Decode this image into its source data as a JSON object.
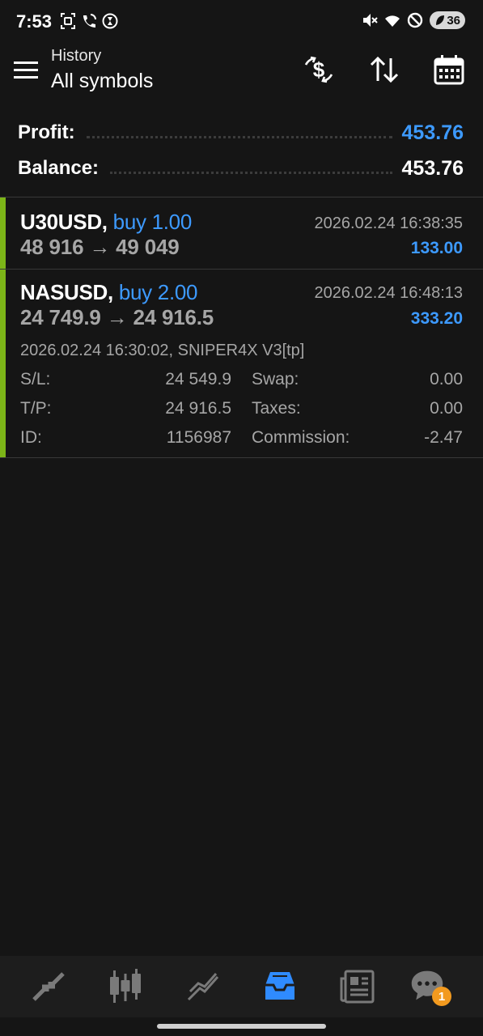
{
  "status_bar": {
    "time": "7:53",
    "battery_level": "36",
    "left_icons": [
      "screen-record-icon",
      "wifi-calling-icon",
      "hourglass-icon"
    ],
    "right_icons": [
      "mute-icon",
      "wifi-icon",
      "do-not-disturb-icon",
      "battery-icon"
    ]
  },
  "header": {
    "subtitle": "History",
    "title": "All symbols",
    "icons": [
      "menu-icon",
      "currency-exchange-icon",
      "sort-icon",
      "calendar-icon"
    ]
  },
  "summary": {
    "profit_label": "Profit:",
    "profit_value": "453.76",
    "balance_label": "Balance:",
    "balance_value": "453.76"
  },
  "deals": [
    {
      "symbol": "U30USD,",
      "action": "buy 1.00",
      "prices": "48 916 → 49 049",
      "close_time": "2026.02.24 16:38:35",
      "profit": "133.00"
    },
    {
      "symbol": "NASUSD,",
      "action": "buy 2.00",
      "prices": "24 749.9 → 24 916.5",
      "close_time": "2026.02.24 16:48:13",
      "profit": "333.20",
      "details": {
        "open_line": "2026.02.24 16:30:02, SNIPER4X V3[tp]",
        "sl_label": "S/L:",
        "sl_value": "24 549.9",
        "tp_label": "T/P:",
        "tp_value": "24 916.5",
        "id_label": "ID:",
        "id_value": "1156987",
        "swap_label": "Swap:",
        "swap_value": "0.00",
        "taxes_label": "Taxes:",
        "taxes_value": "0.00",
        "commission_label": "Commission:",
        "commission_value": "-2.47"
      }
    }
  ],
  "bottom_nav": {
    "items": [
      "quotes-icon",
      "chart-icon",
      "trade-icon",
      "history-icon",
      "news-icon",
      "messages-icon"
    ],
    "active": "history-icon",
    "messages_badge": "1"
  },
  "colors": {
    "background": "#151515",
    "accent_blue": "#3d9aff",
    "profit_bar_green": "#7cb518",
    "muted_text": "#a6a6a6",
    "badge_orange": "#f29a1f"
  }
}
